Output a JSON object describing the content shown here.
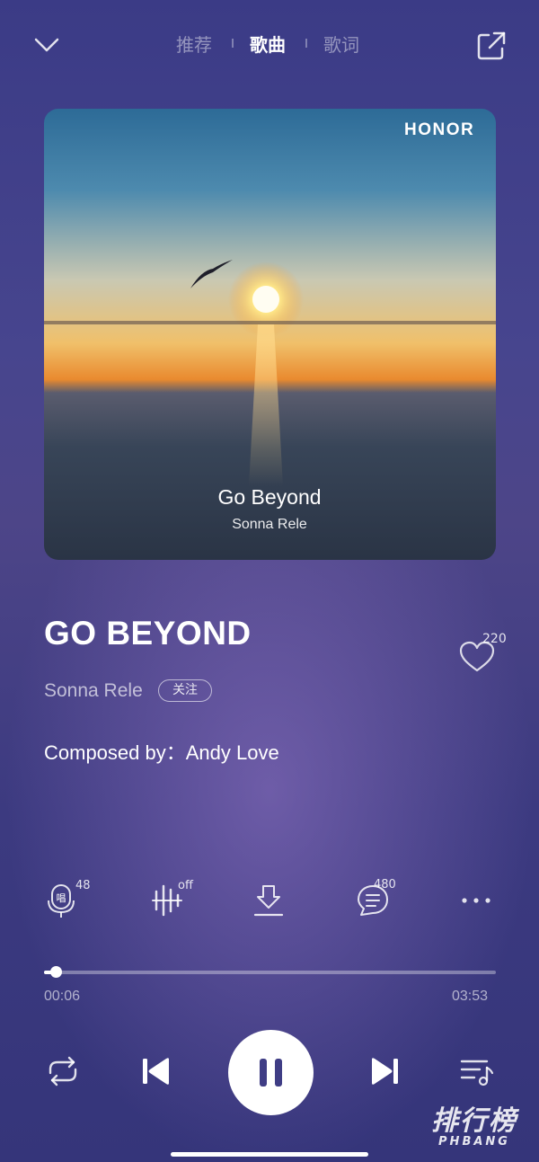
{
  "header": {
    "tabs": [
      {
        "label": "推荐"
      },
      {
        "label": "歌曲"
      },
      {
        "label": "歌词"
      }
    ]
  },
  "album": {
    "brand": "HONOR",
    "title": "Go Beyond",
    "artist": "Sonna Rele"
  },
  "song": {
    "title": "GO BEYOND",
    "artist": "Sonna Rele",
    "follow_label": "关注",
    "composer": "Composed by：Andy Love",
    "likes": "220"
  },
  "actions": {
    "sing_count": "48",
    "sound_effect_status": "off",
    "comments_count": "480"
  },
  "progress": {
    "current": "00:06",
    "total": "03:53",
    "fraction": 0.026
  },
  "watermark": {
    "line1": "排行榜",
    "line2": "PHBANG"
  },
  "colors": {
    "background": "#3f3d85",
    "play_button": "#ffffff",
    "play_icon": "#3f3d85"
  }
}
